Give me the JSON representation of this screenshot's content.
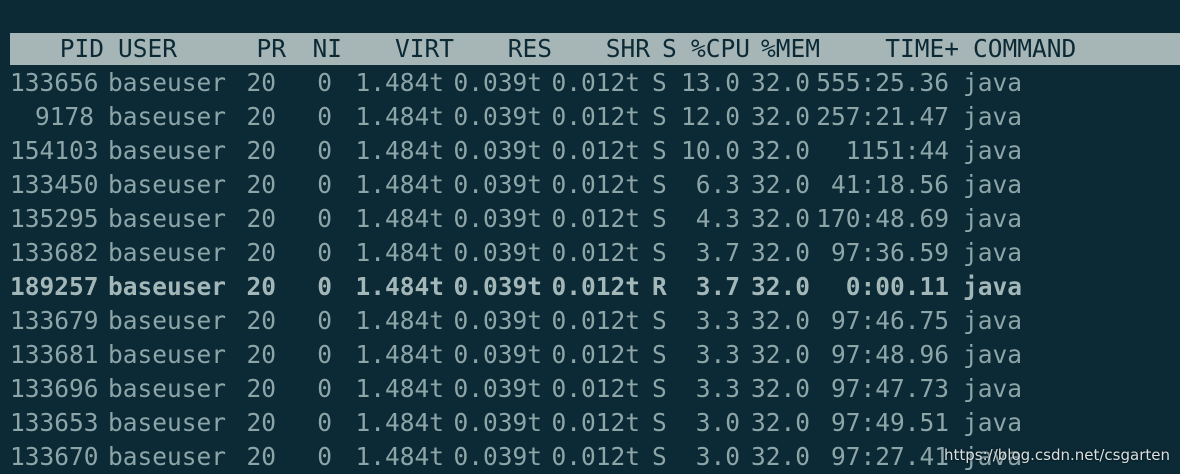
{
  "header": {
    "pid": "PID",
    "user": "USER",
    "pr": "PR",
    "ni": "NI",
    "virt": "VIRT",
    "res": "RES",
    "shr": "SHR",
    "s": "S",
    "cpu": "%CPU",
    "mem": "%MEM",
    "time": "TIME+",
    "command": "COMMAND"
  },
  "rows": [
    {
      "pid": "133656",
      "user": "baseuser",
      "pr": "20",
      "ni": "0",
      "virt": "1.484t",
      "res": "0.039t",
      "shr": "0.012t",
      "s": "S",
      "cpu": "13.0",
      "mem": "32.0",
      "time": "555:25.36",
      "command": "java"
    },
    {
      "pid": "9178",
      "user": "baseuser",
      "pr": "20",
      "ni": "0",
      "virt": "1.484t",
      "res": "0.039t",
      "shr": "0.012t",
      "s": "S",
      "cpu": "12.0",
      "mem": "32.0",
      "time": "257:21.47",
      "command": "java"
    },
    {
      "pid": "154103",
      "user": "baseuser",
      "pr": "20",
      "ni": "0",
      "virt": "1.484t",
      "res": "0.039t",
      "shr": "0.012t",
      "s": "S",
      "cpu": "10.0",
      "mem": "32.0",
      "time": "1151:44",
      "command": "java"
    },
    {
      "pid": "133450",
      "user": "baseuser",
      "pr": "20",
      "ni": "0",
      "virt": "1.484t",
      "res": "0.039t",
      "shr": "0.012t",
      "s": "S",
      "cpu": "6.3",
      "mem": "32.0",
      "time": "41:18.56",
      "command": "java"
    },
    {
      "pid": "135295",
      "user": "baseuser",
      "pr": "20",
      "ni": "0",
      "virt": "1.484t",
      "res": "0.039t",
      "shr": "0.012t",
      "s": "S",
      "cpu": "4.3",
      "mem": "32.0",
      "time": "170:48.69",
      "command": "java"
    },
    {
      "pid": "133682",
      "user": "baseuser",
      "pr": "20",
      "ni": "0",
      "virt": "1.484t",
      "res": "0.039t",
      "shr": "0.012t",
      "s": "S",
      "cpu": "3.7",
      "mem": "32.0",
      "time": "97:36.59",
      "command": "java"
    },
    {
      "pid": "189257",
      "user": "baseuser",
      "pr": "20",
      "ni": "0",
      "virt": "1.484t",
      "res": "0.039t",
      "shr": "0.012t",
      "s": "R",
      "cpu": "3.7",
      "mem": "32.0",
      "time": "0:00.11",
      "command": "java"
    },
    {
      "pid": "133679",
      "user": "baseuser",
      "pr": "20",
      "ni": "0",
      "virt": "1.484t",
      "res": "0.039t",
      "shr": "0.012t",
      "s": "S",
      "cpu": "3.3",
      "mem": "32.0",
      "time": "97:46.75",
      "command": "java"
    },
    {
      "pid": "133681",
      "user": "baseuser",
      "pr": "20",
      "ni": "0",
      "virt": "1.484t",
      "res": "0.039t",
      "shr": "0.012t",
      "s": "S",
      "cpu": "3.3",
      "mem": "32.0",
      "time": "97:48.96",
      "command": "java"
    },
    {
      "pid": "133696",
      "user": "baseuser",
      "pr": "20",
      "ni": "0",
      "virt": "1.484t",
      "res": "0.039t",
      "shr": "0.012t",
      "s": "S",
      "cpu": "3.3",
      "mem": "32.0",
      "time": "97:47.73",
      "command": "java"
    },
    {
      "pid": "133653",
      "user": "baseuser",
      "pr": "20",
      "ni": "0",
      "virt": "1.484t",
      "res": "0.039t",
      "shr": "0.012t",
      "s": "S",
      "cpu": "3.0",
      "mem": "32.0",
      "time": "97:49.51",
      "command": "java"
    },
    {
      "pid": "133670",
      "user": "baseuser",
      "pr": "20",
      "ni": "0",
      "virt": "1.484t",
      "res": "0.039t",
      "shr": "0.012t",
      "s": "S",
      "cpu": "3.0",
      "mem": "32.0",
      "time": "97:27.41",
      "command": "java"
    }
  ],
  "highlighted_row": 6,
  "watermark": "https://blog.csdn.net/csgarten",
  "colors": {
    "background": "#0b2a36",
    "text": "#8ea5a8",
    "header_bg": "#a6b5b5",
    "header_text": "#0b2a36"
  }
}
